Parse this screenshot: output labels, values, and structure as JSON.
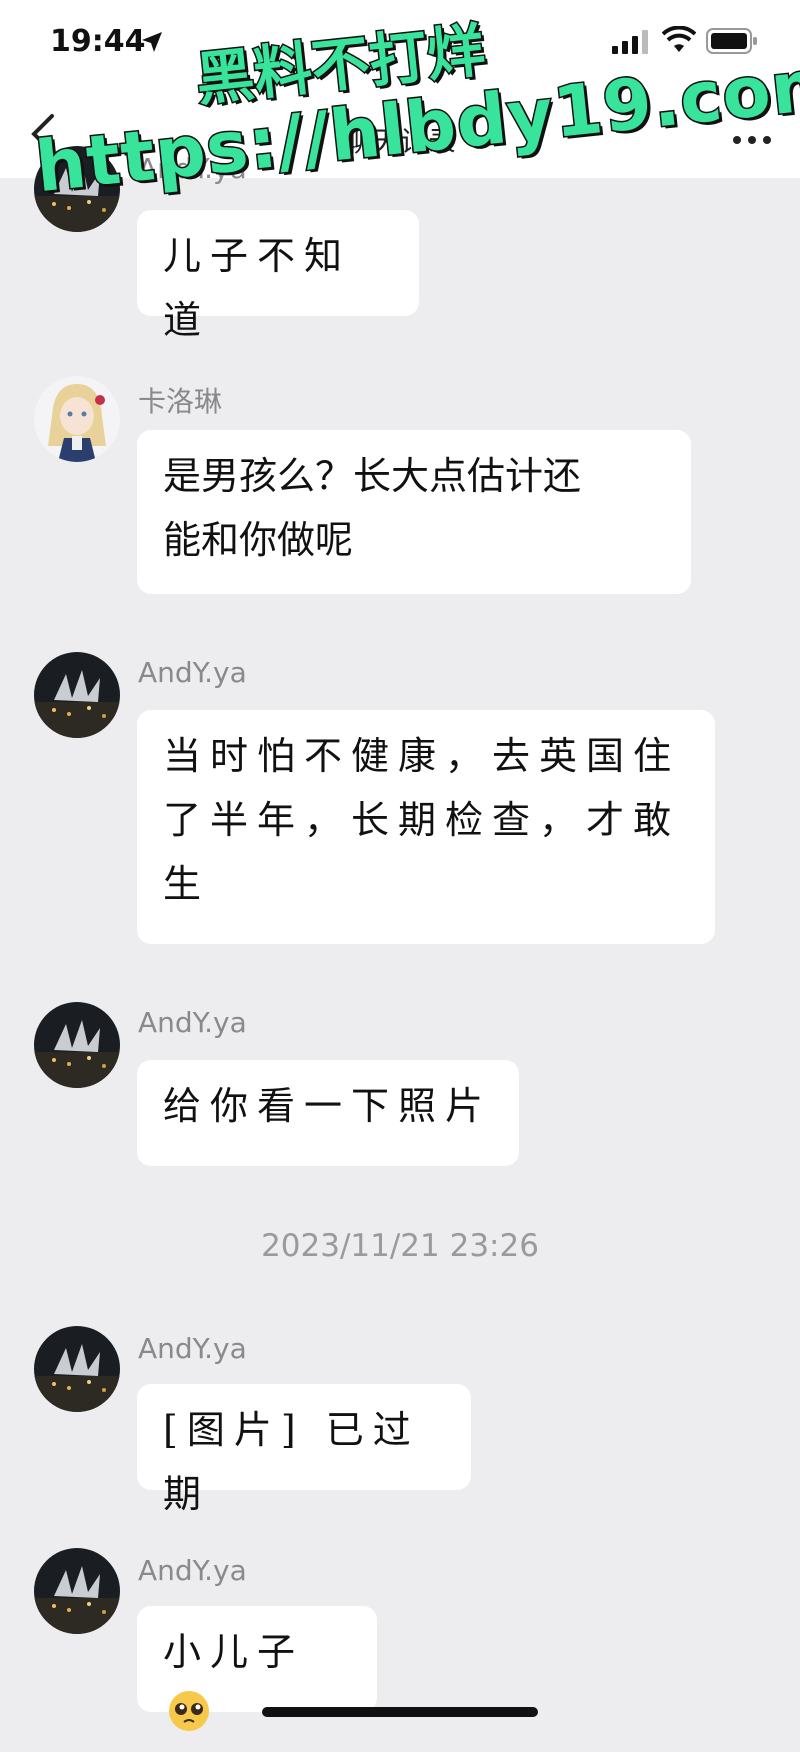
{
  "status_bar": {
    "time": "19:44"
  },
  "nav": {
    "title": "聊天记录"
  },
  "watermark": {
    "line1": "黑料不打烊",
    "line2": "https://hlbdy19.com"
  },
  "messages": [
    {
      "sender": "AndY.ya",
      "text": "儿子不知道"
    },
    {
      "sender": "卡洛琳",
      "text_line1": "是男孩么？长大点估计还",
      "text_line2": "能和你做呢"
    },
    {
      "sender": "AndY.ya",
      "text_line1": "当时怕不健康，去英国住",
      "text_line2": "了半年，长期检查，才敢",
      "text_line3": "生"
    },
    {
      "sender": "AndY.ya",
      "text": "给你看一下照片"
    },
    {
      "sender": "AndY.ya",
      "text": "[图片] 已过期"
    },
    {
      "sender": "AndY.ya",
      "text": "小儿子"
    }
  ],
  "timestamp": "2023/11/21 23:26",
  "colors": {
    "background": "#ededf0",
    "bubble": "#ffffff",
    "watermark": "#38e39b"
  }
}
